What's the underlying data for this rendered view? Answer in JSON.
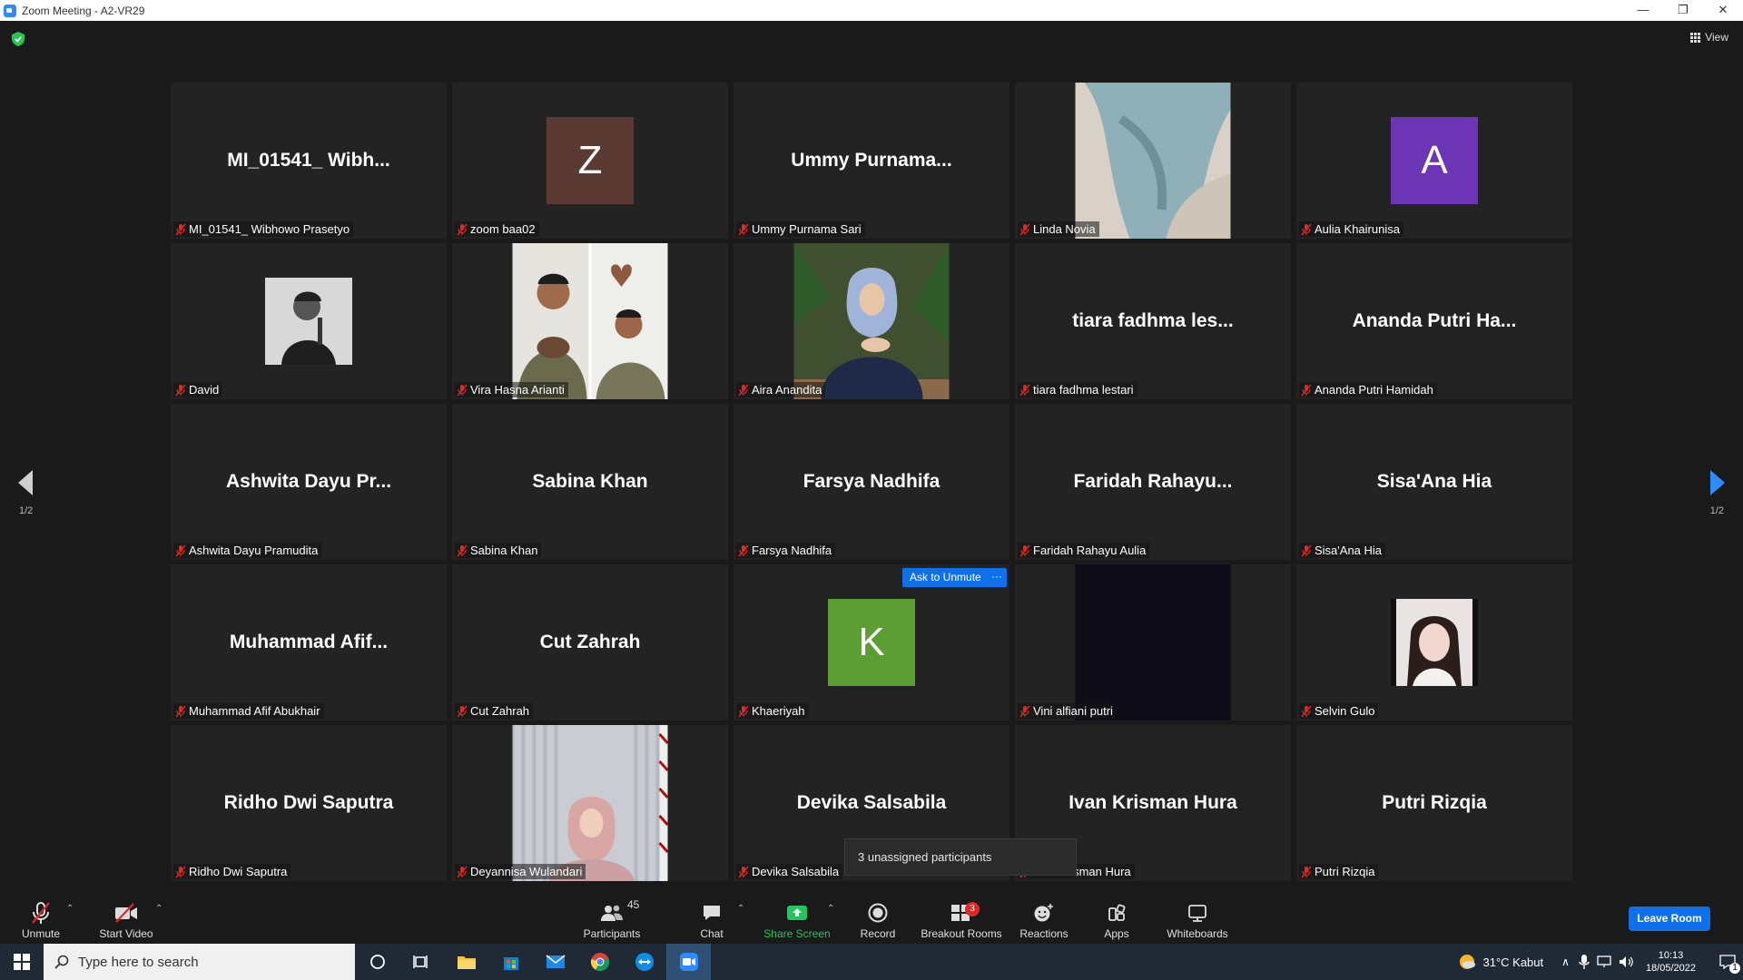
{
  "window": {
    "title": "Zoom Meeting - A2-VR29",
    "controls": [
      "—",
      "❐",
      "✕"
    ]
  },
  "view": {
    "label": "View"
  },
  "pager": {
    "left": "1/2",
    "right": "1/2"
  },
  "tiles": [
    {
      "name": "MI_01541_ Wibhowo Prasetyo",
      "display": "MI_01541_ Wibh...",
      "kind": "text"
    },
    {
      "name": "zoom baa02",
      "kind": "letter",
      "letter": "Z",
      "color": "#5b3a33"
    },
    {
      "name": "Ummy Purnama Sari",
      "display": "Ummy Purnama...",
      "kind": "text"
    },
    {
      "name": "Linda Novia",
      "kind": "photo",
      "photo": "scarf"
    },
    {
      "name": "Aulia Khairunisa",
      "kind": "letter",
      "letter": "A",
      "color": "#6b35b5"
    },
    {
      "name": "David",
      "kind": "photo",
      "photo": "david"
    },
    {
      "name": "Vira Hasna Arianti",
      "kind": "photo",
      "photo": "couple"
    },
    {
      "name": "Aira Anandita",
      "kind": "photo",
      "photo": "hijab"
    },
    {
      "name": "tiara fadhma lestari",
      "display": "tiara fadhma les...",
      "kind": "text"
    },
    {
      "name": "Ananda Putri Hamidah",
      "display": "Ananda Putri Ha...",
      "kind": "text"
    },
    {
      "name": "Ashwita Dayu Pramudita",
      "display": "Ashwita Dayu Pr...",
      "kind": "text"
    },
    {
      "name": "Sabina Khan",
      "display": "Sabina Khan",
      "kind": "text"
    },
    {
      "name": "Farsya Nadhifa",
      "display": "Farsya Nadhifa",
      "kind": "text"
    },
    {
      "name": "Faridah Rahayu Aulia",
      "display": "Faridah Rahayu...",
      "kind": "text"
    },
    {
      "name": "Sisa'Ana Hia",
      "display": "Sisa'Ana Hia",
      "kind": "text"
    },
    {
      "name": "Muhammad Afif Abukhair",
      "display": "Muhammad Afif...",
      "kind": "text"
    },
    {
      "name": "Cut Zahrah",
      "display": "Cut Zahrah",
      "kind": "text"
    },
    {
      "name": "Khaeriyah",
      "kind": "letter",
      "letter": "K",
      "color": "#5c9e34"
    },
    {
      "name": "Vini alfiani putri",
      "kind": "photo",
      "photo": "dark"
    },
    {
      "name": "Selvin Gulo",
      "kind": "photo",
      "photo": "selvin"
    },
    {
      "name": "Ridho Dwi Saputra",
      "display": "Ridho Dwi Saputra",
      "kind": "text"
    },
    {
      "name": "Deyannisa Wulandari",
      "kind": "photo",
      "photo": "curtain"
    },
    {
      "name": "Devika Salsabila",
      "display": "Devika Salsabila",
      "kind": "text"
    },
    {
      "name": "Ivan Krisman Hura",
      "display": "Ivan Krisman Hura",
      "kind": "text"
    },
    {
      "name": "Putri Rizqia",
      "display": "Putri Rizqia",
      "kind": "text"
    }
  ],
  "hover": {
    "ask_unmute": "Ask to Unmute",
    "more": "···"
  },
  "tooltip": "3 unassigned participants",
  "toolbar": {
    "unmute": "Unmute",
    "start_video": "Start Video",
    "participants": "Participants",
    "participants_count": "45",
    "chat": "Chat",
    "share_screen": "Share Screen",
    "record": "Record",
    "breakout_rooms": "Breakout Rooms",
    "breakout_badge": "3",
    "reactions": "Reactions",
    "apps": "Apps",
    "whiteboards": "Whiteboards",
    "leave": "Leave Room"
  },
  "taskbar": {
    "search_placeholder": "Type here to search",
    "weather": "31°C  Kabut",
    "time": "10:13",
    "date": "18/05/2022",
    "notif_count": "1"
  },
  "colors": {
    "accent": "#0e71eb",
    "share_green": "#22c55e",
    "mic_red": "#e02828"
  }
}
